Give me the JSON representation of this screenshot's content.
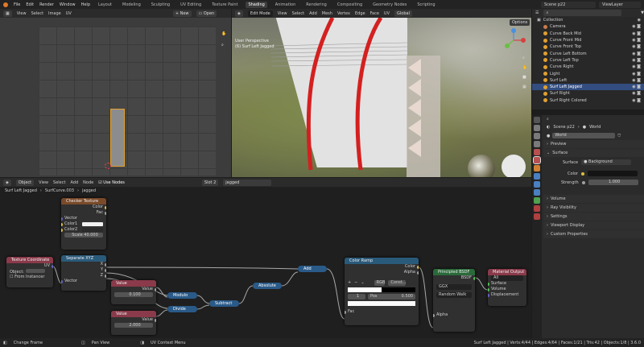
{
  "topbar": {
    "menus": [
      "File",
      "Edit",
      "Render",
      "Window",
      "Help"
    ],
    "workspaces": [
      "Layout",
      "Modeling",
      "Sculpting",
      "UV Editing",
      "Texture Paint",
      "Shading",
      "Animation",
      "Rendering",
      "Compositing",
      "Geometry Nodes",
      "Scripting"
    ],
    "active_workspace": "Shading",
    "scene": "Scene p22",
    "view_layer": "ViewLayer"
  },
  "uv_editor": {
    "header": [
      "View",
      "Select",
      "Image",
      "UV"
    ],
    "new_label": "New",
    "open_label": "Open"
  },
  "viewport": {
    "mode": "Edit Mode",
    "header": [
      "View",
      "Select",
      "Add",
      "Mesh",
      "Vertex",
      "Edge",
      "Face",
      "UV"
    ],
    "transform": "Global",
    "options": "Options",
    "info_line1": "User Perspective",
    "info_line2": "(6) Surf Left Jagged"
  },
  "outliner": {
    "root": "Collection",
    "items": [
      {
        "label": "Camera",
        "color": "#c97b4a"
      },
      {
        "label": "Curve Back Mid",
        "color": "#e0a030"
      },
      {
        "label": "Curve Front Mid",
        "color": "#e0a030"
      },
      {
        "label": "Curve Front Top",
        "color": "#e0a030"
      },
      {
        "label": "Curve Left Bottom",
        "color": "#e0a030"
      },
      {
        "label": "Curve Left Top",
        "color": "#e0a030"
      },
      {
        "label": "Curve Right",
        "color": "#e0a030"
      },
      {
        "label": "Light",
        "color": "#e0a030"
      },
      {
        "label": "Surf Left",
        "color": "#e0a030"
      },
      {
        "label": "Surf Left Jagged",
        "color": "#e0a030",
        "selected": true
      },
      {
        "label": "Surf Right",
        "color": "#e0a030"
      },
      {
        "label": "Surf Right Colored",
        "color": "#e0a030"
      }
    ]
  },
  "properties": {
    "breadcrumb_scene": "Scene p22",
    "breadcrumb_world": "World",
    "world_name": "World",
    "sections": [
      "Preview",
      "Surface"
    ],
    "surface_label": "Surface",
    "surface_value": "Background",
    "color_label": "Color",
    "strength_label": "Strength",
    "strength_value": "1.000",
    "more_sections": [
      "Volume",
      "Ray Visibility",
      "Settings",
      "Viewport Display",
      "Custom Properties"
    ]
  },
  "node_editor": {
    "header": [
      "View",
      "Select",
      "Add",
      "Node"
    ],
    "object_label": "Object",
    "use_nodes": "Use Nodes",
    "slot": "Slot 2",
    "material": "jagged",
    "breadcrumb": [
      "Surf Left Jagged",
      "SurfCurve.003",
      "jagged"
    ],
    "checker": {
      "title": "Checker Texture",
      "outputs": [
        "Color",
        "Fac"
      ],
      "inputs": [
        "Vector",
        "Color1",
        "Color2"
      ],
      "scale_label": "Scale",
      "scale_value": "40.000"
    },
    "texcoord": {
      "title": "Texture Coordinate",
      "output": "UV",
      "object_label": "Object:",
      "from_instancer": "From Instancer"
    },
    "separate": {
      "title": "Separate XYZ",
      "outputs": [
        "X",
        "Y",
        "Z"
      ],
      "input": "Vector"
    },
    "value1": {
      "title": "Value",
      "label": "Value",
      "value": "0.100"
    },
    "value2": {
      "title": "Value",
      "label": "Value",
      "value": "2.000"
    },
    "modulo": "Modulo",
    "divide": "Divide",
    "subtract": "Subtract",
    "absolute": "Absolute",
    "add": "Add",
    "ramp": {
      "title": "Color Ramp",
      "outputs": [
        "Color",
        "Alpha"
      ],
      "mode": "RGB",
      "interp": "Const...",
      "index": "1",
      "pos_label": "Pos",
      "pos_value": "0.500",
      "input": "Fac"
    },
    "bsdf": {
      "title": "Principled BSDF",
      "output": "BSDF",
      "distribution": "GGX",
      "subsurface": "Random Walk",
      "input": "Alpha"
    },
    "output": {
      "title": "Material Output",
      "target": "All",
      "inputs": [
        "Surface",
        "Volume",
        "Displacement"
      ]
    }
  },
  "statusbar": {
    "left1": "Change Frame",
    "left2": "Pan View",
    "left3": "UV Context Menu",
    "right": "Surf Left Jagged | Verts:4/44 | Edges:4/64 | Faces:1/21 | Tris:42 | Objects:1/8 | 3.6.0"
  }
}
